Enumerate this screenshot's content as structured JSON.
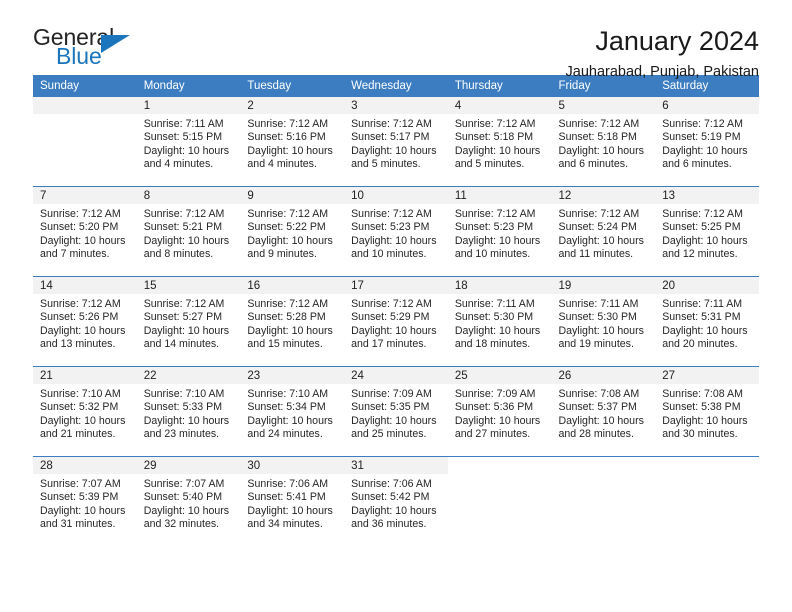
{
  "brand": {
    "name_part1": "General",
    "name_part2": "Blue",
    "triangle_color": "#1b75bc"
  },
  "header": {
    "title": "January 2024",
    "subtitle": "Jauharabad, Punjab, Pakistan"
  },
  "theme": {
    "header_bg": "#3b7dc0",
    "header_text": "#ffffff",
    "daynum_band_bg": "#f2f2f2",
    "row_border": "#3b7dc0"
  },
  "weekdays": [
    "Sunday",
    "Monday",
    "Tuesday",
    "Wednesday",
    "Thursday",
    "Friday",
    "Saturday"
  ],
  "weeks": [
    [
      {
        "day": "",
        "empty": true,
        "sunrise": "",
        "sunset": "",
        "daylight1": "",
        "daylight2": ""
      },
      {
        "day": "1",
        "sunrise": "Sunrise: 7:11 AM",
        "sunset": "Sunset: 5:15 PM",
        "daylight1": "Daylight: 10 hours",
        "daylight2": "and 4 minutes."
      },
      {
        "day": "2",
        "sunrise": "Sunrise: 7:12 AM",
        "sunset": "Sunset: 5:16 PM",
        "daylight1": "Daylight: 10 hours",
        "daylight2": "and 4 minutes."
      },
      {
        "day": "3",
        "sunrise": "Sunrise: 7:12 AM",
        "sunset": "Sunset: 5:17 PM",
        "daylight1": "Daylight: 10 hours",
        "daylight2": "and 5 minutes."
      },
      {
        "day": "4",
        "sunrise": "Sunrise: 7:12 AM",
        "sunset": "Sunset: 5:18 PM",
        "daylight1": "Daylight: 10 hours",
        "daylight2": "and 5 minutes."
      },
      {
        "day": "5",
        "sunrise": "Sunrise: 7:12 AM",
        "sunset": "Sunset: 5:18 PM",
        "daylight1": "Daylight: 10 hours",
        "daylight2": "and 6 minutes."
      },
      {
        "day": "6",
        "sunrise": "Sunrise: 7:12 AM",
        "sunset": "Sunset: 5:19 PM",
        "daylight1": "Daylight: 10 hours",
        "daylight2": "and 6 minutes."
      }
    ],
    [
      {
        "day": "7",
        "sunrise": "Sunrise: 7:12 AM",
        "sunset": "Sunset: 5:20 PM",
        "daylight1": "Daylight: 10 hours",
        "daylight2": "and 7 minutes."
      },
      {
        "day": "8",
        "sunrise": "Sunrise: 7:12 AM",
        "sunset": "Sunset: 5:21 PM",
        "daylight1": "Daylight: 10 hours",
        "daylight2": "and 8 minutes."
      },
      {
        "day": "9",
        "sunrise": "Sunrise: 7:12 AM",
        "sunset": "Sunset: 5:22 PM",
        "daylight1": "Daylight: 10 hours",
        "daylight2": "and 9 minutes."
      },
      {
        "day": "10",
        "sunrise": "Sunrise: 7:12 AM",
        "sunset": "Sunset: 5:23 PM",
        "daylight1": "Daylight: 10 hours",
        "daylight2": "and 10 minutes."
      },
      {
        "day": "11",
        "sunrise": "Sunrise: 7:12 AM",
        "sunset": "Sunset: 5:23 PM",
        "daylight1": "Daylight: 10 hours",
        "daylight2": "and 10 minutes."
      },
      {
        "day": "12",
        "sunrise": "Sunrise: 7:12 AM",
        "sunset": "Sunset: 5:24 PM",
        "daylight1": "Daylight: 10 hours",
        "daylight2": "and 11 minutes."
      },
      {
        "day": "13",
        "sunrise": "Sunrise: 7:12 AM",
        "sunset": "Sunset: 5:25 PM",
        "daylight1": "Daylight: 10 hours",
        "daylight2": "and 12 minutes."
      }
    ],
    [
      {
        "day": "14",
        "sunrise": "Sunrise: 7:12 AM",
        "sunset": "Sunset: 5:26 PM",
        "daylight1": "Daylight: 10 hours",
        "daylight2": "and 13 minutes."
      },
      {
        "day": "15",
        "sunrise": "Sunrise: 7:12 AM",
        "sunset": "Sunset: 5:27 PM",
        "daylight1": "Daylight: 10 hours",
        "daylight2": "and 14 minutes."
      },
      {
        "day": "16",
        "sunrise": "Sunrise: 7:12 AM",
        "sunset": "Sunset: 5:28 PM",
        "daylight1": "Daylight: 10 hours",
        "daylight2": "and 15 minutes."
      },
      {
        "day": "17",
        "sunrise": "Sunrise: 7:12 AM",
        "sunset": "Sunset: 5:29 PM",
        "daylight1": "Daylight: 10 hours",
        "daylight2": "and 17 minutes."
      },
      {
        "day": "18",
        "sunrise": "Sunrise: 7:11 AM",
        "sunset": "Sunset: 5:30 PM",
        "daylight1": "Daylight: 10 hours",
        "daylight2": "and 18 minutes."
      },
      {
        "day": "19",
        "sunrise": "Sunrise: 7:11 AM",
        "sunset": "Sunset: 5:30 PM",
        "daylight1": "Daylight: 10 hours",
        "daylight2": "and 19 minutes."
      },
      {
        "day": "20",
        "sunrise": "Sunrise: 7:11 AM",
        "sunset": "Sunset: 5:31 PM",
        "daylight1": "Daylight: 10 hours",
        "daylight2": "and 20 minutes."
      }
    ],
    [
      {
        "day": "21",
        "sunrise": "Sunrise: 7:10 AM",
        "sunset": "Sunset: 5:32 PM",
        "daylight1": "Daylight: 10 hours",
        "daylight2": "and 21 minutes."
      },
      {
        "day": "22",
        "sunrise": "Sunrise: 7:10 AM",
        "sunset": "Sunset: 5:33 PM",
        "daylight1": "Daylight: 10 hours",
        "daylight2": "and 23 minutes."
      },
      {
        "day": "23",
        "sunrise": "Sunrise: 7:10 AM",
        "sunset": "Sunset: 5:34 PM",
        "daylight1": "Daylight: 10 hours",
        "daylight2": "and 24 minutes."
      },
      {
        "day": "24",
        "sunrise": "Sunrise: 7:09 AM",
        "sunset": "Sunset: 5:35 PM",
        "daylight1": "Daylight: 10 hours",
        "daylight2": "and 25 minutes."
      },
      {
        "day": "25",
        "sunrise": "Sunrise: 7:09 AM",
        "sunset": "Sunset: 5:36 PM",
        "daylight1": "Daylight: 10 hours",
        "daylight2": "and 27 minutes."
      },
      {
        "day": "26",
        "sunrise": "Sunrise: 7:08 AM",
        "sunset": "Sunset: 5:37 PM",
        "daylight1": "Daylight: 10 hours",
        "daylight2": "and 28 minutes."
      },
      {
        "day": "27",
        "sunrise": "Sunrise: 7:08 AM",
        "sunset": "Sunset: 5:38 PM",
        "daylight1": "Daylight: 10 hours",
        "daylight2": "and 30 minutes."
      }
    ],
    [
      {
        "day": "28",
        "sunrise": "Sunrise: 7:07 AM",
        "sunset": "Sunset: 5:39 PM",
        "daylight1": "Daylight: 10 hours",
        "daylight2": "and 31 minutes."
      },
      {
        "day": "29",
        "sunrise": "Sunrise: 7:07 AM",
        "sunset": "Sunset: 5:40 PM",
        "daylight1": "Daylight: 10 hours",
        "daylight2": "and 32 minutes."
      },
      {
        "day": "30",
        "sunrise": "Sunrise: 7:06 AM",
        "sunset": "Sunset: 5:41 PM",
        "daylight1": "Daylight: 10 hours",
        "daylight2": "and 34 minutes."
      },
      {
        "day": "31",
        "sunrise": "Sunrise: 7:06 AM",
        "sunset": "Sunset: 5:42 PM",
        "daylight1": "Daylight: 10 hours",
        "daylight2": "and 36 minutes."
      },
      {
        "day": "",
        "empty": true,
        "blank": true,
        "sunrise": "",
        "sunset": "",
        "daylight1": "",
        "daylight2": ""
      },
      {
        "day": "",
        "empty": true,
        "blank": true,
        "sunrise": "",
        "sunset": "",
        "daylight1": "",
        "daylight2": ""
      },
      {
        "day": "",
        "empty": true,
        "blank": true,
        "sunrise": "",
        "sunset": "",
        "daylight1": "",
        "daylight2": ""
      }
    ]
  ]
}
